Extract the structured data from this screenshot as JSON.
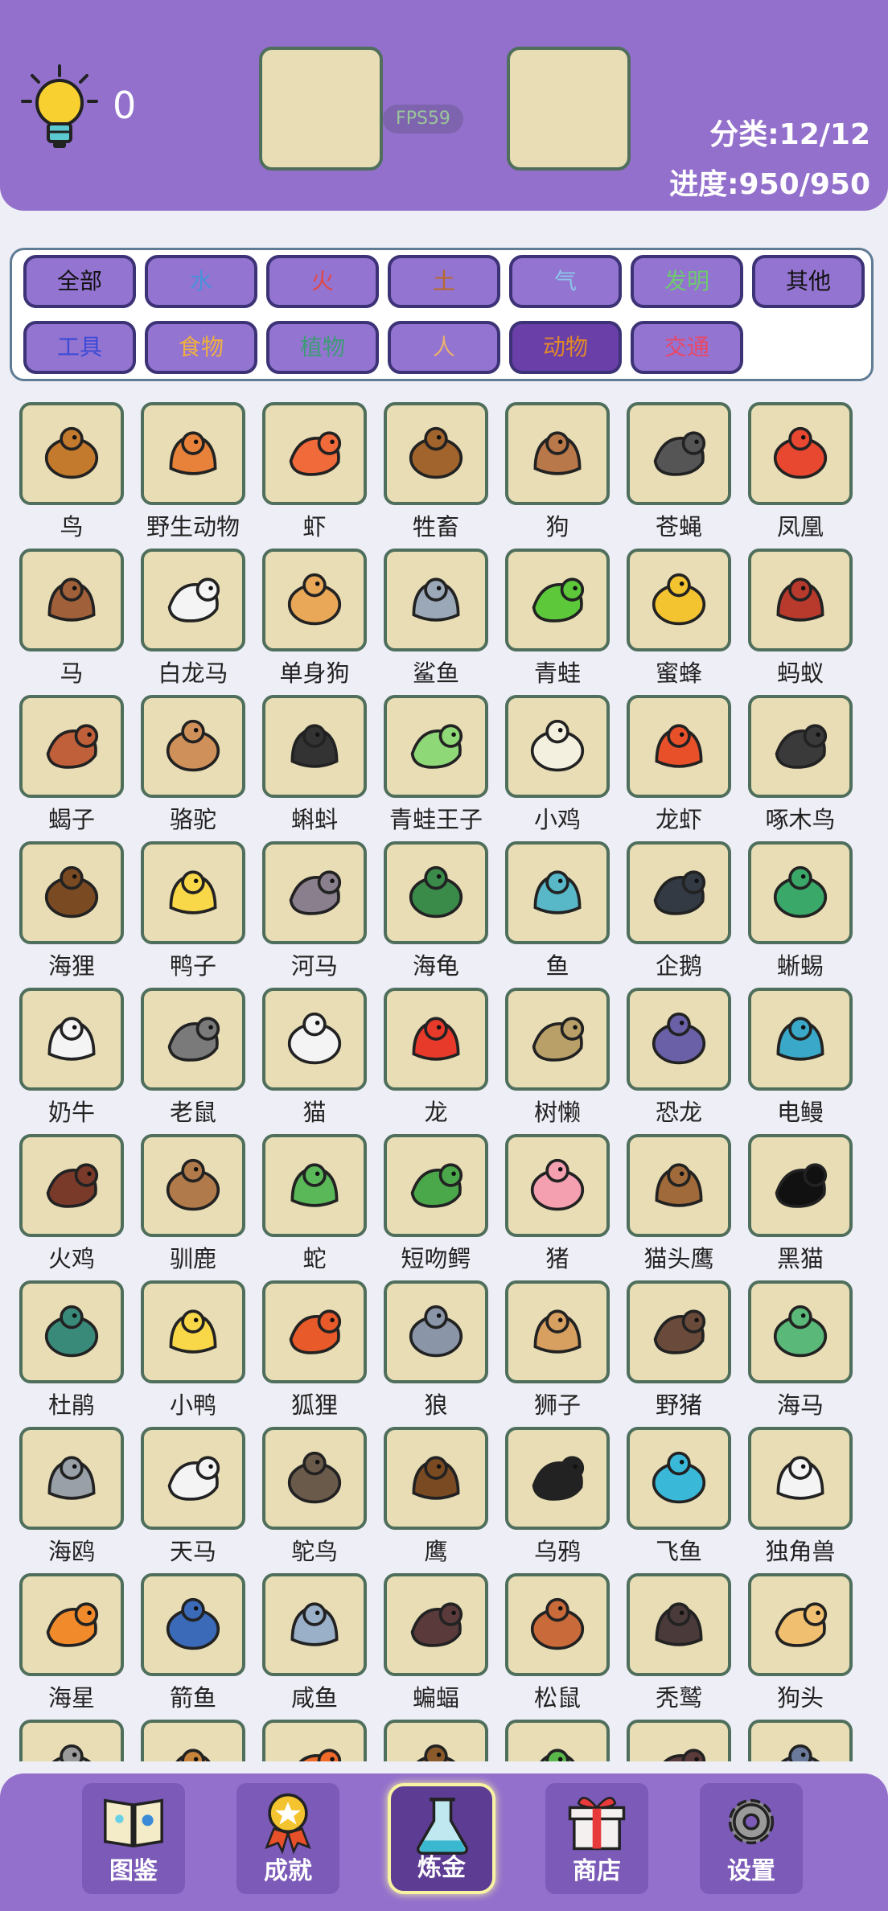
{
  "header": {
    "hint_count": "0",
    "fps": "FPS59",
    "category_stat": "分类:12/12",
    "progress_stat": "进度:950/950"
  },
  "categories": [
    {
      "label": "全部",
      "color": "#111111"
    },
    {
      "label": "水",
      "color": "#4a90d9"
    },
    {
      "label": "火",
      "color": "#e04848"
    },
    {
      "label": "土",
      "color": "#b86a28"
    },
    {
      "label": "气",
      "color": "#8ec4ea"
    },
    {
      "label": "发明",
      "color": "#6fc870"
    },
    {
      "label": "其他",
      "color": "#111111"
    },
    {
      "label": "工具",
      "color": "#3a4ad8"
    },
    {
      "label": "食物",
      "color": "#f0b040"
    },
    {
      "label": "植物",
      "color": "#3f9a78"
    },
    {
      "label": "人",
      "color": "#e8b070"
    },
    {
      "label": "动物",
      "color": "#e08a2a",
      "selected": true
    },
    {
      "label": "交通",
      "color": "#e84868"
    }
  ],
  "items": [
    {
      "label": "鸟",
      "color": "#c47a2c",
      "icon": "bird-icon"
    },
    {
      "label": "野生动物",
      "color": "#e8823a",
      "icon": "tiger-icon"
    },
    {
      "label": "虾",
      "color": "#f06a3a",
      "icon": "shrimp-icon"
    },
    {
      "label": "牲畜",
      "color": "#a0642c",
      "icon": "ox-icon"
    },
    {
      "label": "狗",
      "color": "#b8784a",
      "icon": "dog-icon"
    },
    {
      "label": "苍蝇",
      "color": "#555555",
      "icon": "fly-icon"
    },
    {
      "label": "凤凰",
      "color": "#e84830",
      "icon": "phoenix-icon"
    },
    {
      "label": "马",
      "color": "#a0603a",
      "icon": "horse-icon"
    },
    {
      "label": "白龙马",
      "color": "#f4f4f4",
      "icon": "white-horse-icon"
    },
    {
      "label": "单身狗",
      "color": "#e8a858",
      "icon": "single-dog-icon"
    },
    {
      "label": "鲨鱼",
      "color": "#9aa8b8",
      "icon": "shark-icon"
    },
    {
      "label": "青蛙",
      "color": "#5cc83a",
      "icon": "frog-icon"
    },
    {
      "label": "蜜蜂",
      "color": "#f4c430",
      "icon": "bee-icon"
    },
    {
      "label": "蚂蚁",
      "color": "#b83a2c",
      "icon": "ant-icon"
    },
    {
      "label": "蝎子",
      "color": "#c0603a",
      "icon": "scorpion-icon"
    },
    {
      "label": "骆驼",
      "color": "#d0905a",
      "icon": "camel-icon"
    },
    {
      "label": "蝌蚪",
      "color": "#333333",
      "icon": "tadpole-icon"
    },
    {
      "label": "青蛙王子",
      "color": "#8ed878",
      "icon": "frog-prince-icon"
    },
    {
      "label": "小鸡",
      "color": "#f4f0e0",
      "icon": "chick-icon"
    },
    {
      "label": "龙虾",
      "color": "#e8502a",
      "icon": "lobster-icon"
    },
    {
      "label": "啄木鸟",
      "color": "#3a3a3a",
      "icon": "woodpecker-icon"
    },
    {
      "label": "海狸",
      "color": "#7a4a22",
      "icon": "beaver-icon"
    },
    {
      "label": "鸭子",
      "color": "#f8d848",
      "icon": "duck-icon"
    },
    {
      "label": "河马",
      "color": "#8a7f8c",
      "icon": "hippo-icon"
    },
    {
      "label": "海龟",
      "color": "#3a8a4a",
      "icon": "turtle-icon"
    },
    {
      "label": "鱼",
      "color": "#58b8c8",
      "icon": "fish-icon"
    },
    {
      "label": "企鹅",
      "color": "#333a44",
      "icon": "penguin-icon"
    },
    {
      "label": "蜥蜴",
      "color": "#3aa868",
      "icon": "lizard-icon"
    },
    {
      "label": "奶牛",
      "color": "#f4f4f4",
      "icon": "cow-icon"
    },
    {
      "label": "老鼠",
      "color": "#7a7a7a",
      "icon": "mouse-icon"
    },
    {
      "label": "猫",
      "color": "#f4f4f4",
      "icon": "cat-icon"
    },
    {
      "label": "龙",
      "color": "#e83a2a",
      "icon": "dragon-icon"
    },
    {
      "label": "树懒",
      "color": "#b8a068",
      "icon": "sloth-icon"
    },
    {
      "label": "恐龙",
      "color": "#6a60a8",
      "icon": "dinosaur-icon"
    },
    {
      "label": "电鳗",
      "color": "#3aa8c8",
      "icon": "eel-icon"
    },
    {
      "label": "火鸡",
      "color": "#7a3a2a",
      "icon": "turkey-icon"
    },
    {
      "label": "驯鹿",
      "color": "#b07a4a",
      "icon": "reindeer-icon"
    },
    {
      "label": "蛇",
      "color": "#5ab858",
      "icon": "snake-icon"
    },
    {
      "label": "短吻鳄",
      "color": "#4aa84a",
      "icon": "alligator-icon"
    },
    {
      "label": "猪",
      "color": "#f4a0b0",
      "icon": "pig-icon"
    },
    {
      "label": "猫头鹰",
      "color": "#a06a3a",
      "icon": "owl-icon"
    },
    {
      "label": "黑猫",
      "color": "#111111",
      "icon": "black-cat-icon"
    },
    {
      "label": "杜鹃",
      "color": "#3a8a7a",
      "icon": "cuckoo-icon"
    },
    {
      "label": "小鸭",
      "color": "#f8d848",
      "icon": "duckling-icon"
    },
    {
      "label": "狐狸",
      "color": "#e85a2a",
      "icon": "fox-icon"
    },
    {
      "label": "狼",
      "color": "#8a96a8",
      "icon": "wolf-icon"
    },
    {
      "label": "狮子",
      "color": "#d8a060",
      "icon": "lion-icon"
    },
    {
      "label": "野猪",
      "color": "#6a4a3a",
      "icon": "boar-icon"
    },
    {
      "label": "海马",
      "color": "#5ab878",
      "icon": "seahorse-icon"
    },
    {
      "label": "海鸥",
      "color": "#9aa0a8",
      "icon": "seagull-icon"
    },
    {
      "label": "天马",
      "color": "#f4f4f4",
      "icon": "pegasus-icon"
    },
    {
      "label": "鸵鸟",
      "color": "#6a5a4a",
      "icon": "ostrich-icon"
    },
    {
      "label": "鹰",
      "color": "#7a4a22",
      "icon": "eagle-icon"
    },
    {
      "label": "乌鸦",
      "color": "#222222",
      "icon": "crow-icon"
    },
    {
      "label": "飞鱼",
      "color": "#3ab8d8",
      "icon": "flying-fish-icon"
    },
    {
      "label": "独角兽",
      "color": "#f4f4f4",
      "icon": "unicorn-icon"
    },
    {
      "label": "海星",
      "color": "#f08a2a",
      "icon": "starfish-icon"
    },
    {
      "label": "箭鱼",
      "color": "#3a6ab8",
      "icon": "swordfish-icon"
    },
    {
      "label": "咸鱼",
      "color": "#9ab0c8",
      "icon": "salted-fish-icon"
    },
    {
      "label": "蝙蝠",
      "color": "#5a3a3a",
      "icon": "bat-icon"
    },
    {
      "label": "松鼠",
      "color": "#c86a3a",
      "icon": "squirrel-icon"
    },
    {
      "label": "秃鹫",
      "color": "#4a3a3a",
      "icon": "vulture-icon"
    },
    {
      "label": "狗头",
      "color": "#f0c070",
      "icon": "doge-icon"
    },
    {
      "label": "",
      "color": "#9a9a9a",
      "icon": "goat-icon"
    },
    {
      "label": "",
      "color": "#c8843a",
      "icon": "kangaroo-icon"
    },
    {
      "label": "",
      "color": "#f06a2a",
      "icon": "clownfish-icon"
    },
    {
      "label": "",
      "color": "#8a5a2a",
      "icon": "bear-icon"
    },
    {
      "label": "",
      "color": "#5ab84a",
      "icon": "insect-icon"
    },
    {
      "label": "",
      "color": "#5a3a3a",
      "icon": "moose-icon"
    },
    {
      "label": "",
      "color": "#6a7a9a",
      "icon": "elephant-icon"
    }
  ],
  "bottom_nav": [
    {
      "label": "图鉴",
      "icon": "book-icon"
    },
    {
      "label": "成就",
      "icon": "medal-icon"
    },
    {
      "label": "炼金",
      "icon": "flask-icon",
      "active": true
    },
    {
      "label": "商店",
      "icon": "gift-icon"
    },
    {
      "label": "设置",
      "icon": "gear-icon"
    }
  ]
}
